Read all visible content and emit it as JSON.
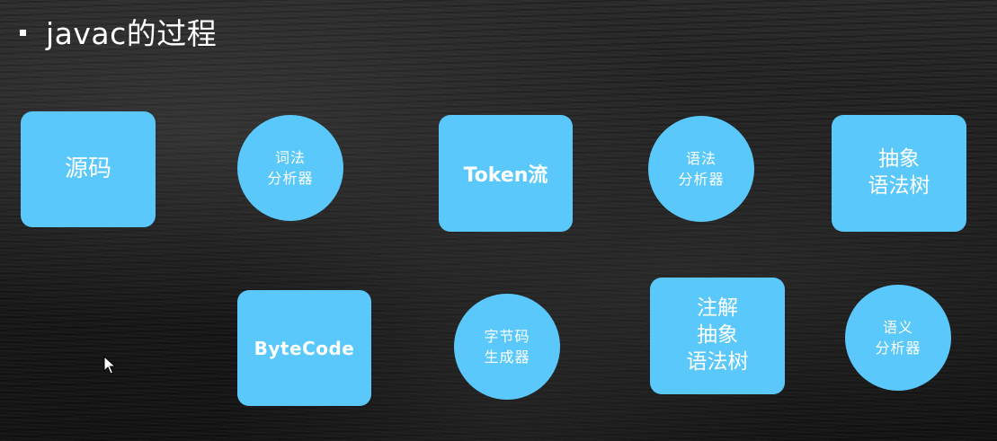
{
  "title": "javac的过程",
  "nodes": {
    "source": "源码",
    "lexer": "词法\n分析器",
    "token_stream": "Token流",
    "parser": "语法\n分析器",
    "ast": "抽象\n语法树",
    "bytecode": "ByteCode",
    "bytecode_generator": "字节码\n生成器",
    "annotated_ast": "注解\n抽象\n语法树",
    "semantic_analyzer": "语义\n分析器"
  },
  "colors": {
    "node_fill": "#5ac8fa",
    "node_text": "#ffffff",
    "title_text": "#ffffff"
  }
}
